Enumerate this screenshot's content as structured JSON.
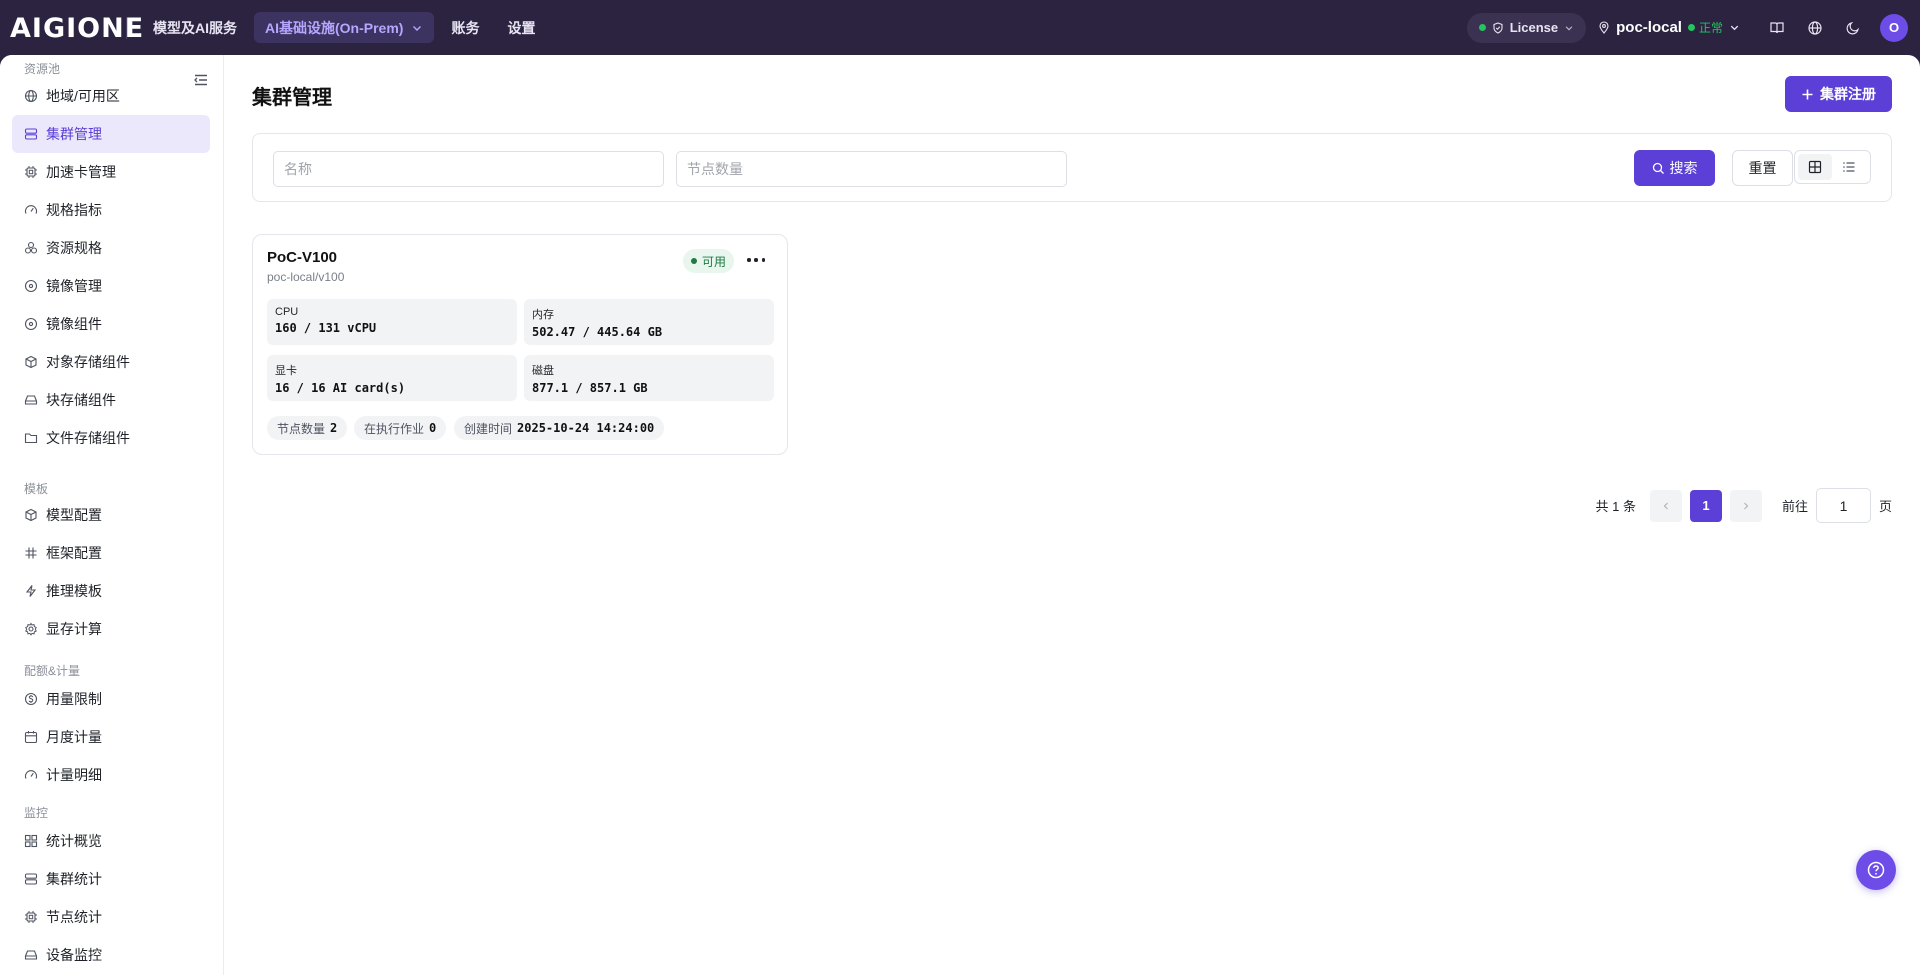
{
  "brand": {
    "logo_text": "AIGIONE"
  },
  "topnav": {
    "items": [
      {
        "label": "模型及AI服务"
      },
      {
        "label": "AI基础设施(On-Prem)"
      },
      {
        "label": "账务"
      },
      {
        "label": "设置"
      }
    ]
  },
  "topright": {
    "license_label": "License",
    "region_name": "poc-local",
    "region_status": "正常",
    "avatar_letter": "O"
  },
  "sidebar": {
    "sections": [
      {
        "title": "资源池",
        "items": [
          "地域/可用区",
          "集群管理",
          "加速卡管理",
          "规格指标",
          "资源规格",
          "镜像管理",
          "镜像组件",
          "对象存储组件",
          "块存储组件",
          "文件存储组件"
        ]
      },
      {
        "title": "模板",
        "items": [
          "模型配置",
          "框架配置",
          "推理模板",
          "显存计算"
        ]
      },
      {
        "title": "配额&计量",
        "items": [
          "用量限制",
          "月度计量",
          "计量明细"
        ]
      },
      {
        "title": "监控",
        "items": [
          "统计概览",
          "集群统计",
          "节点统计",
          "设备监控"
        ]
      }
    ],
    "active_item": "集群管理"
  },
  "page": {
    "title": "集群管理",
    "register_button": "集群注册"
  },
  "filter": {
    "name_placeholder": "名称",
    "nodes_placeholder": "节点数量",
    "search_button": "搜索",
    "reset_button": "重置"
  },
  "cluster_card": {
    "name": "PoC-V100",
    "path": "poc-local/v100",
    "status": "可用",
    "cpu_label": "CPU",
    "cpu_value": "160 / 131 vCPU",
    "mem_label": "内存",
    "mem_value": "502.47 / 445.64 GB",
    "gpu_label": "显卡",
    "gpu_value": "16 / 16 AI card(s)",
    "disk_label": "磁盘",
    "disk_value": "877.1 / 857.1 GB",
    "nodes_label": "节点数量",
    "nodes_value": "2",
    "jobs_label": "在执行作业",
    "jobs_value": "0",
    "created_label": "创建时间",
    "created_value": "2025-10-24 14:24:00"
  },
  "pagination": {
    "total_text": "共 1 条",
    "current_page": "1",
    "goto_label": "前往",
    "goto_value": "1",
    "page_suffix": "页"
  },
  "colors": {
    "accent": "#5b3fd6",
    "topbar": "#2b2340",
    "success": "#22c55e"
  }
}
